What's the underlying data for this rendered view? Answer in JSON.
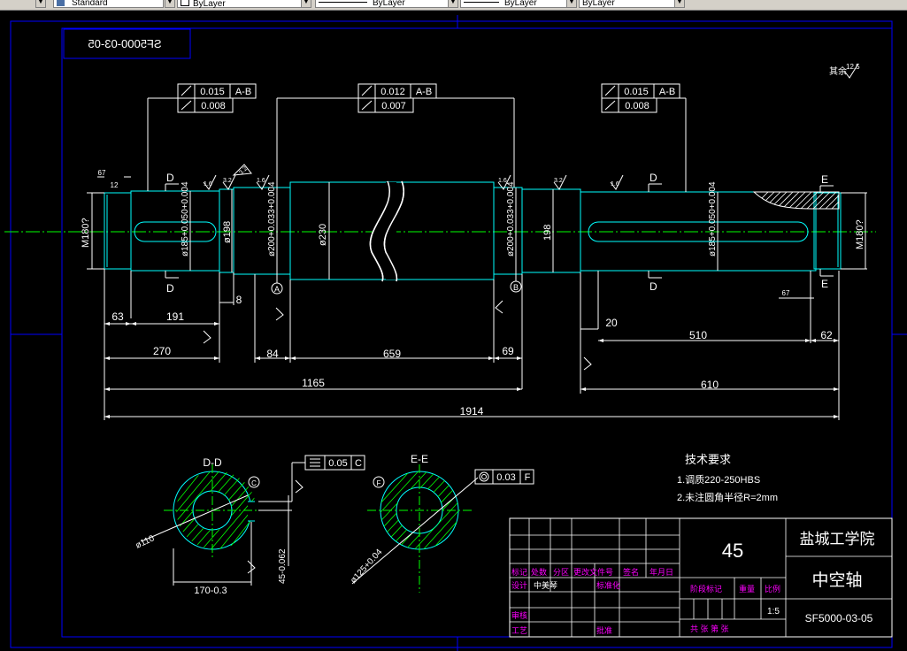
{
  "toolbar": {
    "text_style": "Standard",
    "layer": "ByLayer",
    "linetype": "ByLayer",
    "lineweight": "ByLayer",
    "plotstyle": "ByLayer"
  },
  "drawing": {
    "mirrored_code": "SF5000-03-05",
    "surface_finish": "其余",
    "surface_finish_value": "12.5",
    "fcf_left": {
      "runout": "0.015",
      "datum": "A-B",
      "cyl": "0.008"
    },
    "fcf_mid": {
      "runout": "0.012",
      "datum": "A-B",
      "cyl": "0.007"
    },
    "fcf_right": {
      "runout": "0.015",
      "datum": "A-B",
      "cyl": "0.008"
    },
    "diameters": {
      "m_left": "M180?",
      "m_right": "M180?",
      "d185_left": "ø185+0.050+0.004",
      "d198_left": "ø198",
      "d200_left": "ø200+0.033+0.004",
      "d230": "ø230",
      "d200_right": "ø200+0.033+0.004",
      "d198_right": "198",
      "d185_right": "ø185+0.050+0.004"
    },
    "section_marks": {
      "d": "D",
      "e": "E",
      "a": "A",
      "b": "B"
    },
    "roughness": {
      "r16": "1.6",
      "r32": "3.2",
      "r12": "12"
    },
    "chamfer": "67",
    "chamfer_small": "12",
    "dims": {
      "d63": "63",
      "d191": "191",
      "d8": "8",
      "d270": "270",
      "d84": "84",
      "d659": "659",
      "d69": "69",
      "d1165": "1165",
      "d20": "20",
      "d510": "510",
      "d62": "62",
      "d610": "610",
      "d1914": "1914"
    },
    "section_dd": {
      "title": "D-D",
      "mark": "C",
      "dia": "ø110",
      "width": "170-0.3",
      "depth": "45-0.062",
      "fcf_val": "0.05",
      "fcf_datum": "C"
    },
    "section_ee": {
      "title": "E-E",
      "mark": "F",
      "dia": "ø125+0.04",
      "fcf_val": "0.03",
      "fcf_datum": "F"
    },
    "notes": {
      "title": "技术要求",
      "line1": "1.调质220-250HBS",
      "line2": "2.未注圆角半径R=2mm"
    },
    "title_block": {
      "material": "45",
      "school": "盐城工学院",
      "part_name": "中空轴",
      "code": "SF5000-03-05",
      "scale": "1:5",
      "h_mark": "标记",
      "h_count": "处数",
      "h_zone": "分区",
      "h_doc": "更改文件号",
      "h_sign": "签名",
      "h_date": "年月日",
      "h_design": "设计",
      "designer": "中美琴",
      "h_std": "标准化",
      "h_stage": "阶段标记",
      "h_weight": "重量",
      "h_ratio": "比例",
      "h_check": "审核",
      "h_process": "工艺",
      "h_approve": "批准",
      "h_sheets": "共 张 第 张"
    }
  }
}
